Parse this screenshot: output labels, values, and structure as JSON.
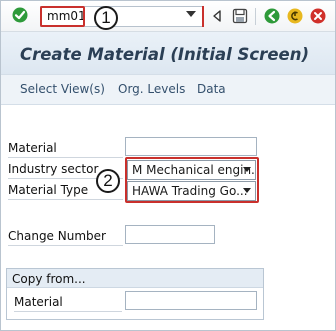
{
  "toolbar": {
    "command_value": "mm01",
    "icons": [
      "check-icon",
      "back-triangle-icon",
      "save-icon",
      "back-icon",
      "exit-icon",
      "cancel-icon"
    ],
    "callout_1": "1"
  },
  "title": "Create Material (Initial Screen)",
  "appbar": {
    "items": [
      "Select View(s)",
      "Org. Levels",
      "Data"
    ]
  },
  "form": {
    "material_label": "Material",
    "industry_sector_label": "Industry sector",
    "industry_sector_value": "M Mechanical engin...",
    "material_type_label": "Material Type",
    "material_type_value": "HAWA Trading Go...",
    "change_number_label": "Change Number",
    "callout_2": "2"
  },
  "copy_from": {
    "header": "Copy from...",
    "material_label": "Material"
  },
  "colors": {
    "callout_border": "#c9302c",
    "title_text": "#2b3f55",
    "appbar_text": "#34506d",
    "check_green": "#2e9a3a",
    "exit_yellow": "#e8b81f",
    "cancel_red": "#d0302a"
  }
}
